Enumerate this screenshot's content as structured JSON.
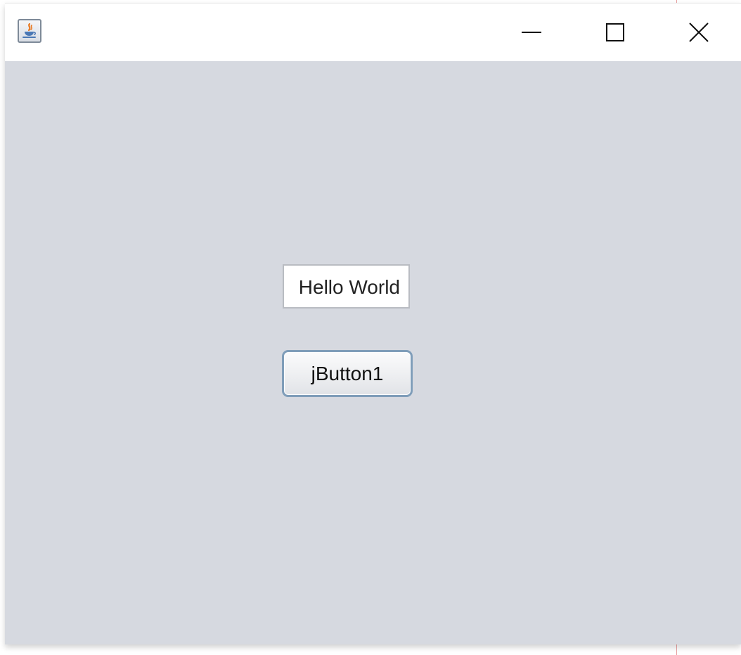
{
  "window": {
    "app_icon": "java-coffee-cup-icon",
    "controls": {
      "minimize_icon": "minimize-icon",
      "maximize_icon": "maximize-icon",
      "close_icon": "close-icon"
    }
  },
  "form": {
    "text_field_value": "Hello World",
    "button_label": "jButton1"
  },
  "colors": {
    "content_background": "#d6d9e0",
    "titlebar_background": "#ffffff",
    "button_border": "#7f9db9"
  }
}
